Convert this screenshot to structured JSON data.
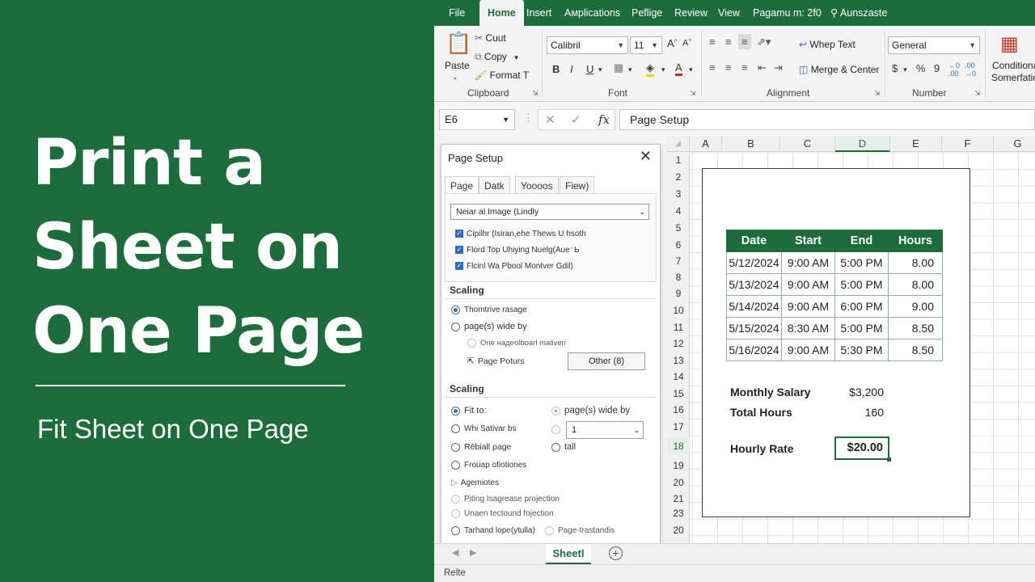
{
  "hero": {
    "title": "Print a Sheet on One Page",
    "subtitle": "Fit Sheet on One Page"
  },
  "menu": {
    "tabs": [
      "File",
      "Home",
      "Insert",
      "Aмplications",
      "Peflige",
      "Review",
      "View",
      "Pagamu m: 2f0",
      "Aunszaste"
    ],
    "active": "Home"
  },
  "ribbon": {
    "clipboard": {
      "paste": "Paste",
      "cut": "Cuut",
      "copy": "Copy",
      "format": "Format T",
      "label": "Clipboard"
    },
    "font": {
      "family": "Calibril",
      "size": "11",
      "label": "Font",
      "bold": "B",
      "italic": "I",
      "underline": "U"
    },
    "alignment": {
      "wrap": "Whep Text",
      "merge": "Merge & Center",
      "label": "Alignment"
    },
    "number": {
      "format": "General",
      "currency": "$",
      "percent": "%",
      "comma": "9",
      "label": "Number"
    },
    "styles": {
      "conditional_line1": "Conditiona",
      "conditional_line2": "Somerfatio"
    }
  },
  "formula_bar": {
    "cell_ref": "E6",
    "fx": "fx",
    "value": "Page Setup"
  },
  "grid": {
    "columns": [
      "A",
      "B",
      "C",
      "D",
      "E",
      "F",
      "G"
    ],
    "selected_column": "D",
    "rows": [
      "1",
      "2",
      "3",
      "4",
      "5",
      "6",
      "7",
      "8",
      "9",
      "10",
      "11",
      "12",
      "13",
      "14",
      "15",
      "16",
      "17",
      "18",
      "19",
      "20",
      "21",
      "23",
      "20"
    ],
    "selected_row": "18"
  },
  "timesheet": {
    "headers": [
      "Date",
      "Start",
      "End",
      "Hours"
    ],
    "rows": [
      [
        "5/12/2024",
        "9:00 AM",
        "5:00 PM",
        "8.00"
      ],
      [
        "5/13/2024",
        "9:00 AM",
        "5:00 PM",
        "8.00"
      ],
      [
        "5/14/2024",
        "9:00 AM",
        "6:00 PM",
        "9.00"
      ],
      [
        "5/15/2024",
        "8:30 AM",
        "5:00 PM",
        "8.50"
      ],
      [
        "5/16/2024",
        "9:00 AM",
        "5:30 PM",
        "8.50"
      ]
    ],
    "monthly_salary_label": "Monthly Salary",
    "monthly_salary": "$3,200",
    "total_hours_label": "Total Hours",
    "total_hours": "160",
    "hourly_rate_label": "Hourly Rate",
    "hourly_rate": "$20.00"
  },
  "dialog": {
    "title": "Page Setup",
    "tabs": [
      "Page",
      "Datk",
      "Yoooos",
      "Fiew)"
    ],
    "active_tab": "Page",
    "select_value": "Neiar al Image (Lindly",
    "checks": [
      "Cipilhr (Isiran,ehe Thews U hsoth",
      "Flord Top Uhiying Nuelg(Aue⁻Ь",
      "Flcinl Wa Pbool Montver Gdil)"
    ],
    "scaling_label": "Scaling",
    "scaling_option1": "Thomtrive rasage",
    "scaling_option2": "page(s) wide by",
    "scaling_sub": "One надeolboarl maliven",
    "page_potours": "Page Poturs",
    "other_button": "Other (8)",
    "scaling2_label": "Scaling",
    "fit_to": "Fit to:",
    "wide_by": "page(s) wide by",
    "what_sativar": "Whi Sativar bs",
    "fit_value": "1",
    "rebiall": "Rēbiall page",
    "tall": "tall",
    "frouap": "Frouap ofiotiones",
    "agemotes": "Agemiotes",
    "piting": "Piting Isagrease projection",
    "unaen": "Unaen tectound fojection",
    "tarhand": "Tarhand lope(ytulla)",
    "page_trastandis": "Page-trastandis"
  },
  "sheet_tabs": {
    "active": "Sheetl"
  },
  "status": {
    "text": "Relte"
  },
  "colors": {
    "brand_green": "#1e6b3c",
    "checkbox_blue": "#2f6fb5"
  }
}
